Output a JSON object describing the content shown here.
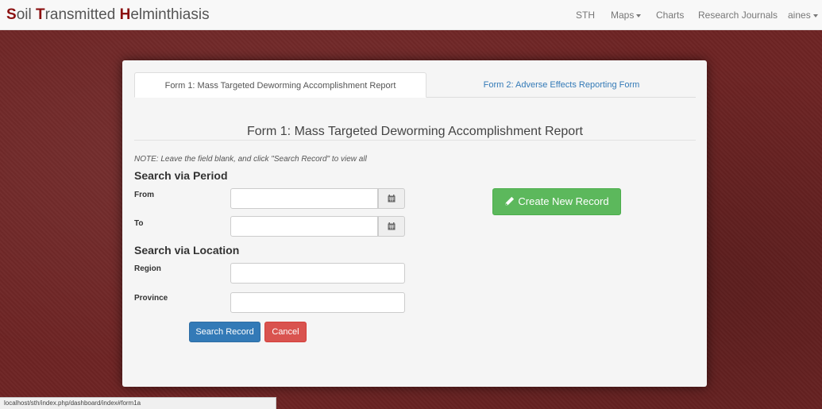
{
  "brand": {
    "word1_cap": "S",
    "word1_rest": "oil ",
    "word2_cap": "T",
    "word2_rest": "ransmitted ",
    "word3_cap": "H",
    "word3_rest": "elminthiasis"
  },
  "nav": {
    "items": [
      {
        "label": "STH"
      },
      {
        "label": "Maps"
      },
      {
        "label": "Charts"
      },
      {
        "label": "Research Journals"
      },
      {
        "label": "aines"
      }
    ]
  },
  "tabs": [
    {
      "label": "Form 1: Mass Targeted Deworming Accomplishment Report",
      "active": true
    },
    {
      "label": "Form 2: Adverse Effects Reporting Form",
      "active": false
    }
  ],
  "form": {
    "title": "Form 1: Mass Targeted Deworming Accomplishment Report",
    "note": "NOTE: Leave the field blank, and click \"Search Record\" to view all",
    "period_heading": "Search via Period",
    "from_label": "From",
    "from_value": "",
    "to_label": "To",
    "to_value": "",
    "location_heading": "Search via Location",
    "region_label": "Region",
    "region_value": "",
    "province_label": "Province",
    "province_value": "",
    "search_button": "Search Record",
    "cancel_button": "Cancel",
    "create_button": "Create New Record"
  },
  "status_bar": {
    "url": "localhost/sth/index.php/dashboard/index#form1a"
  },
  "colors": {
    "brand_accent": "#8b1010",
    "primary": "#337ab7",
    "danger": "#d9534f",
    "success": "#5cb85c",
    "background": "#6e2424"
  },
  "icons": {
    "calendar": "calendar-icon",
    "pencil": "pencil-icon",
    "dropdown": "caret-down-icon"
  }
}
